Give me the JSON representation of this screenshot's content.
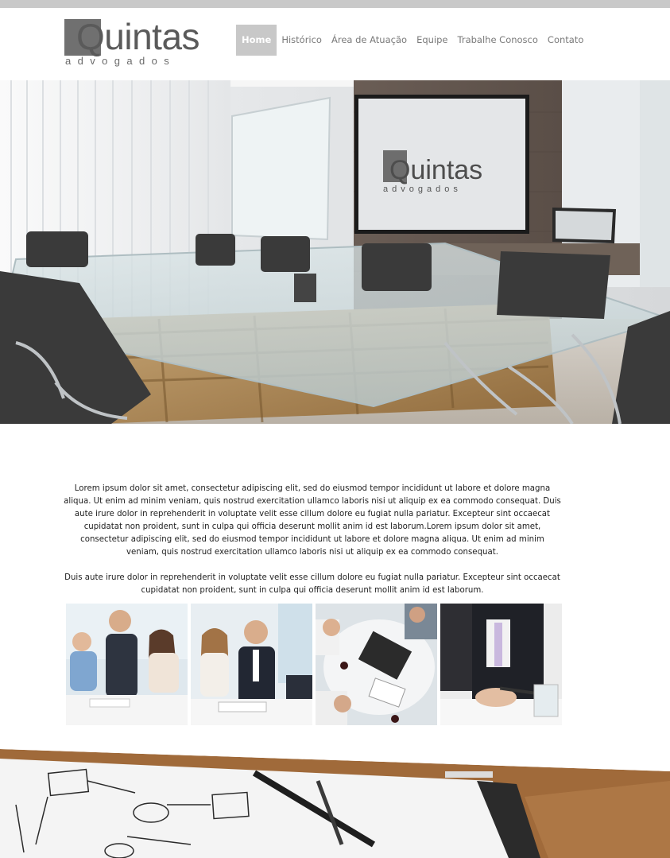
{
  "brand": {
    "logo_word": "Quintas",
    "logo_sub": "advogados"
  },
  "nav": {
    "items": [
      {
        "label": "Home",
        "active": true
      },
      {
        "label": "Histórico",
        "active": false
      },
      {
        "label": "Área de Atuação",
        "active": false
      },
      {
        "label": "Equipe",
        "active": false
      },
      {
        "label": "Trabalhe Conosco",
        "active": false
      },
      {
        "label": "Contato",
        "active": false
      }
    ]
  },
  "hero": {
    "screen_logo_word": "Quintas",
    "screen_logo_sub": "advogados"
  },
  "intro": {
    "paragraph1": "Lorem ipsum dolor sit amet, consectetur adipiscing elit, sed do eiusmod tempor incididunt ut labore et dolore magna aliqua. Ut enim ad minim veniam, quis nostrud exercitation ullamco laboris nisi ut aliquip ex ea commodo consequat. Duis aute irure dolor in reprehenderit in voluptate velit esse cillum dolore eu fugiat nulla pariatur. Excepteur sint occaecat cupidatat non proident, sunt in culpa qui officia deserunt mollit anim id est laborum.Lorem ipsum dolor sit amet, consectetur adipiscing elit, sed do eiusmod tempor incididunt ut labore et dolore magna aliqua. Ut enim ad minim veniam, quis nostrud exercitation ullamco laboris nisi ut aliquip ex ea commodo consequat.",
    "paragraph2": "Duis aute irure dolor in reprehenderit in voluptate velit esse cillum dolore eu fugiat nulla pariatur. Excepteur sint occaecat cupidatat non proident, sunt in culpa qui officia deserunt mollit anim id est laborum."
  },
  "colors": {
    "nav_active_bg": "#c8c8c8",
    "logo_gray": "#707070",
    "top_strip": "#c9c9c9"
  }
}
